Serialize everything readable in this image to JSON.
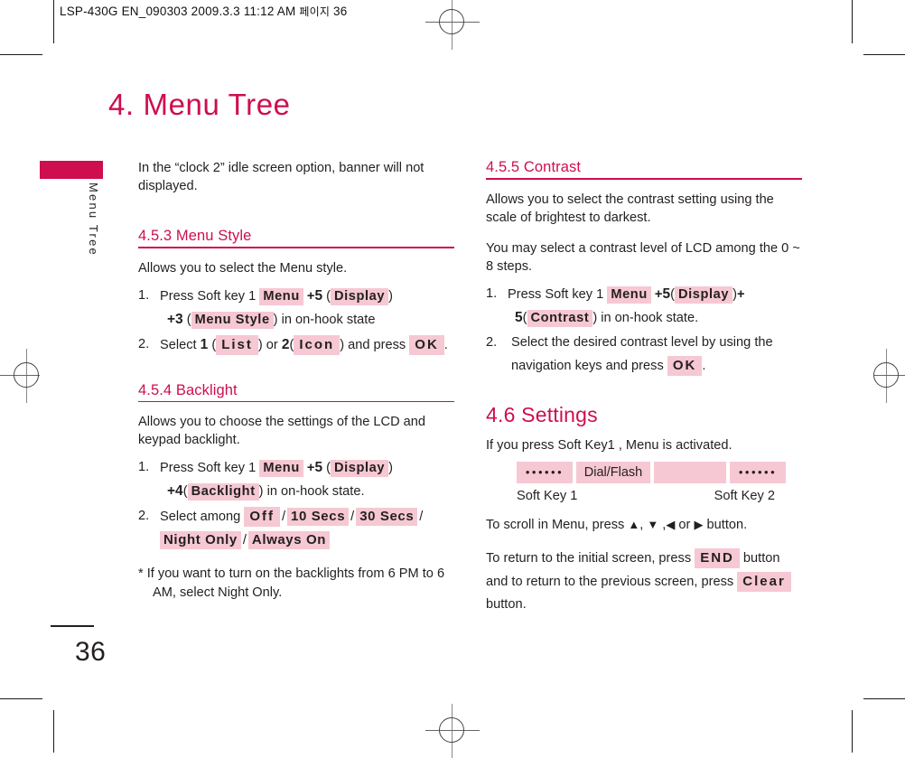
{
  "print_marks": {
    "slug_text": "LSP-430G EN_090303  2009.3.3 11:12 AM",
    "slug_korean": "페이지",
    "slug_page": "36"
  },
  "sidebar": {
    "tab_label": "Menu Tree"
  },
  "page": {
    "title": "4. Menu Tree",
    "number": "36",
    "accent_color": "#ce0e4e",
    "highlight_color": "#f6c8d3"
  },
  "left_column": {
    "intro": "In the “clock 2” idle screen option, banner will not displayed.",
    "section_menu_style": {
      "heading": "4.5.3 Menu Style",
      "description": "Allows you to select the Menu style.",
      "step1": {
        "num": "1.",
        "text_a": "Press Soft key 1",
        "key_menu": "Menu",
        "plus": "+",
        "digit_5": "5",
        "paren_open": "(",
        "key_display": "Display",
        "paren_close": ")",
        "line2_plus_digit": "+3",
        "line2_paren_open": "(",
        "key_menu_style": "Menu Style",
        "line2_paren_close": ")",
        "line2_tail": "in on-hook state"
      },
      "step2": {
        "num": "2.",
        "text_a": "Select",
        "digit_1": "1",
        "paren_open": "(",
        "key_list": "List",
        "paren_close": ")",
        "text_or": "or",
        "digit_2": "2",
        "paren_open2": "(",
        "key_icon": "Icon",
        "paren_close2": ")",
        "text_b": "and press",
        "key_ok": "OK",
        "period": "."
      }
    },
    "section_backlight": {
      "heading": "4.5.4 Backlight",
      "description": "Allows you to choose the settings of the LCD and keypad backlight.",
      "step1": {
        "num": "1.",
        "text_a": "Press Soft key 1",
        "key_menu": "Menu",
        "plus": "+",
        "digit_5": "5",
        "paren_open": "(",
        "key_display": "Display",
        "paren_close": ")",
        "line2_plus_digit": "+4",
        "line2_paren_open": "(",
        "key_backlight": "Backlight",
        "line2_paren_close": ")",
        "line2_tail": "in on-hook state."
      },
      "step2": {
        "num": "2.",
        "text_a": "Select among",
        "options": [
          "Off",
          "10 Secs",
          "30 Secs",
          "Night Only",
          "Always On"
        ],
        "separator": "/"
      },
      "footnote": "* If you want to turn on the backlights from 6 PM to 6 AM, select Night Only."
    }
  },
  "right_column": {
    "section_contrast": {
      "heading": "4.5.5 Contrast",
      "description1": "Allows you to select the contrast setting using the scale of brightest to darkest.",
      "description2": "You may select a contrast level of LCD among the 0 ~ 8 steps.",
      "step1": {
        "num": "1.",
        "text_a": "Press Soft key 1",
        "key_menu": "Menu",
        "plus": "+",
        "digit_5": "5",
        "paren_open": "(",
        "key_display": "Display",
        "paren_close": ")",
        "plus_tail": "+",
        "line2_digit": "5",
        "line2_paren_open": "(",
        "key_contrast": "Contrast",
        "line2_paren_close": ")",
        "line2_tail": "in on-hook state."
      },
      "step2": {
        "num": "2.",
        "text_a": "Select the desired contrast level by using the navigation keys and press",
        "key_ok": "OK",
        "period": "."
      }
    },
    "section_settings": {
      "heading": "4.6 Settings",
      "description": "If you press Soft Key1 , Menu is activated.",
      "softbar": {
        "cell1_dots": "••••••",
        "cell2_label": "Dial/Flash",
        "cell3_label": "",
        "cell4_dots": "••••••",
        "left_name": "Soft Key 1",
        "right_name": "Soft Key 2"
      },
      "scroll_text_a": "To scroll in Menu, press",
      "arrow_up": "▲",
      "arrow_down": "▼",
      "arrow_left": "◀",
      "arrow_right": "▶",
      "scroll_comma1": ",",
      "scroll_comma2": ",",
      "scroll_or": "or",
      "scroll_text_b": "button.",
      "return_text_a": "To return to the initial screen, press",
      "key_end": "END",
      "return_text_b": "button and to return to the previous screen, press",
      "key_clear": "Clear",
      "return_text_c": "button."
    }
  }
}
